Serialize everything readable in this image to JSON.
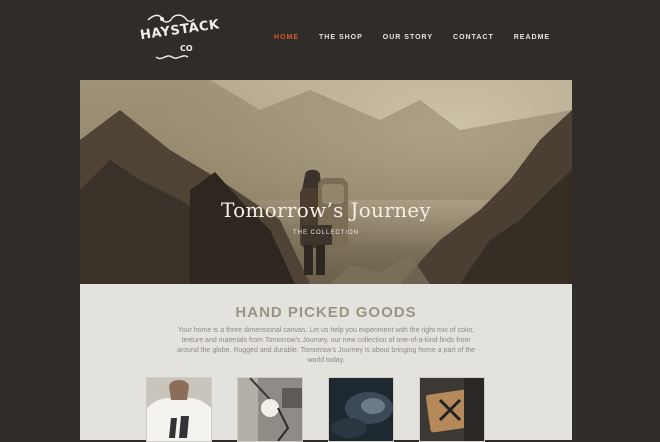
{
  "brand": {
    "name": "HAYSTACK",
    "suffix": "CO"
  },
  "nav": {
    "items": [
      {
        "label": "HOME",
        "active": true
      },
      {
        "label": "THE SHOP"
      },
      {
        "label": "OUR STORY"
      },
      {
        "label": "CONTACT"
      },
      {
        "label": "README"
      }
    ]
  },
  "hero": {
    "title": "Tomorrow’s Journey",
    "subtitle": "THE COLLECTION"
  },
  "section": {
    "title": "HAND PICKED GOODS",
    "text": "Your home is a three dimensional canvas. Let us help you experiment with the right mix of color, texture and materials from Tomorrow's Journey, our new collection of one-of-a-kind finds from around the globe. Rugged and durable, Tomorrow's Journey is about bringing home a part of the world today."
  },
  "colors": {
    "background": "#2f2c2a",
    "accent": "#d9582b",
    "content_bg": "#e4e2dd"
  }
}
